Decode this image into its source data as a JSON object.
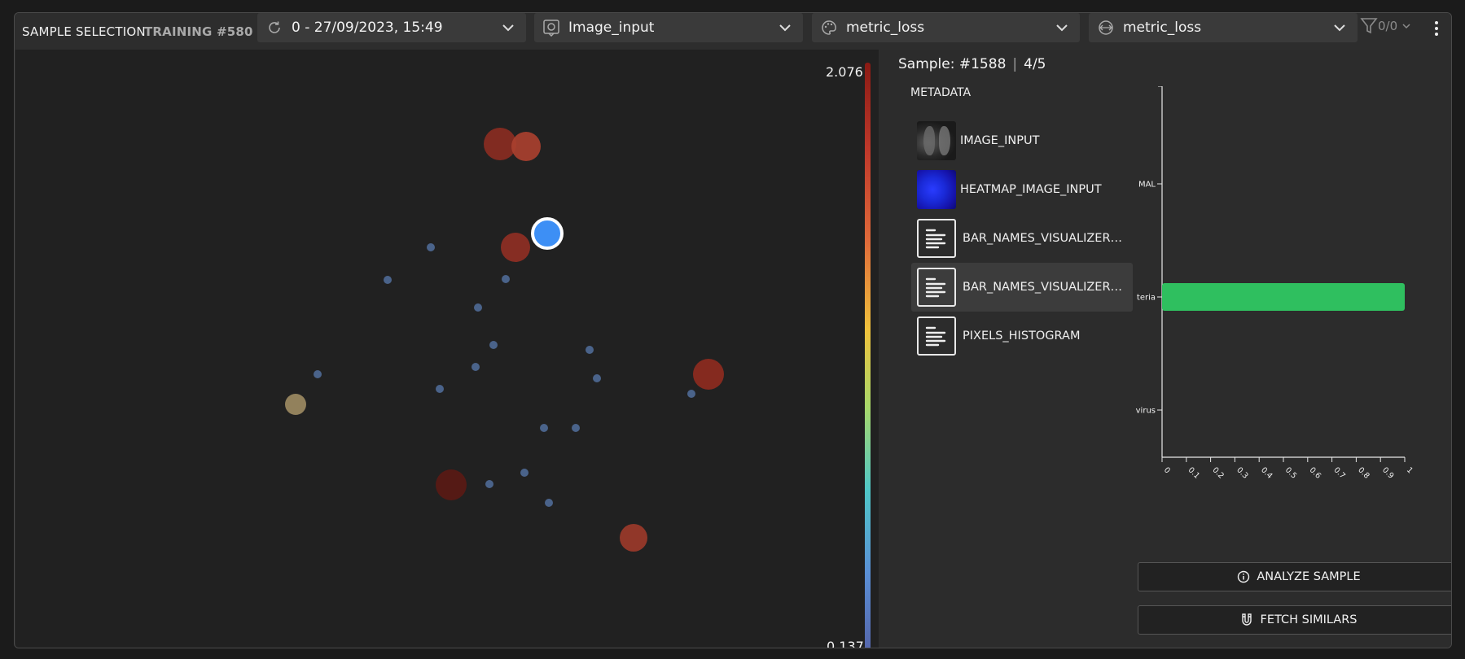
{
  "header": {
    "title": "SAMPLE SELECTION",
    "training": "TRAINING #580",
    "checkpoint_dropdown": "0 - 27/09/2023, 15:49",
    "input_dropdown": "Image_input",
    "color_dropdown": "metric_loss",
    "size_dropdown": "metric_loss",
    "filter_count": "0/0"
  },
  "colorbar": {
    "max": "2.076",
    "min": "0.137"
  },
  "scatter_points": [
    {
      "loss": 1.9,
      "kind": "large"
    },
    {
      "loss": 1.5,
      "kind": "large"
    },
    {
      "loss": 1.6,
      "kind": "large"
    },
    {
      "loss": 1.75,
      "kind": "large"
    },
    {
      "loss": 1.3,
      "kind": "medium"
    },
    {
      "loss": 2.05,
      "kind": "large"
    },
    {
      "loss": 1.55,
      "kind": "large"
    },
    {
      "kind": "selected"
    }
  ],
  "sidebar": {
    "sample_label": "Sample: #1588",
    "position": "4/5",
    "metadata_title": "METADATA",
    "items": [
      {
        "label": "IMAGE_INPUT",
        "icon": "xray-thumbnail"
      },
      {
        "label": "HEATMAP_IMAGE_INPUT",
        "icon": "heatmap-thumbnail"
      },
      {
        "label": "BAR_NAMES_VISUALIZER_P...",
        "icon": "text-lines-icon"
      },
      {
        "label": "BAR_NAMES_VISUALIZER_GT",
        "icon": "text-lines-icon",
        "selected": true
      },
      {
        "label": "PIXELS_HISTOGRAM",
        "icon": "text-lines-icon"
      }
    ],
    "analyze_button": "ANALYZE SAMPLE",
    "fetch_button": "FETCH SIMILARS"
  },
  "chart_data": {
    "type": "bar",
    "orientation": "horizontal",
    "categories": [
      "MAL",
      "teria",
      "virus"
    ],
    "values": [
      0,
      1,
      0
    ],
    "xlim": [
      0,
      1
    ],
    "xticks": [
      "0",
      "0.1",
      "0.2",
      "0.3",
      "0.4",
      "0.5",
      "0.6",
      "0.7",
      "0.8",
      "0.9",
      "1"
    ],
    "bar_color": "#2fbf5f"
  }
}
